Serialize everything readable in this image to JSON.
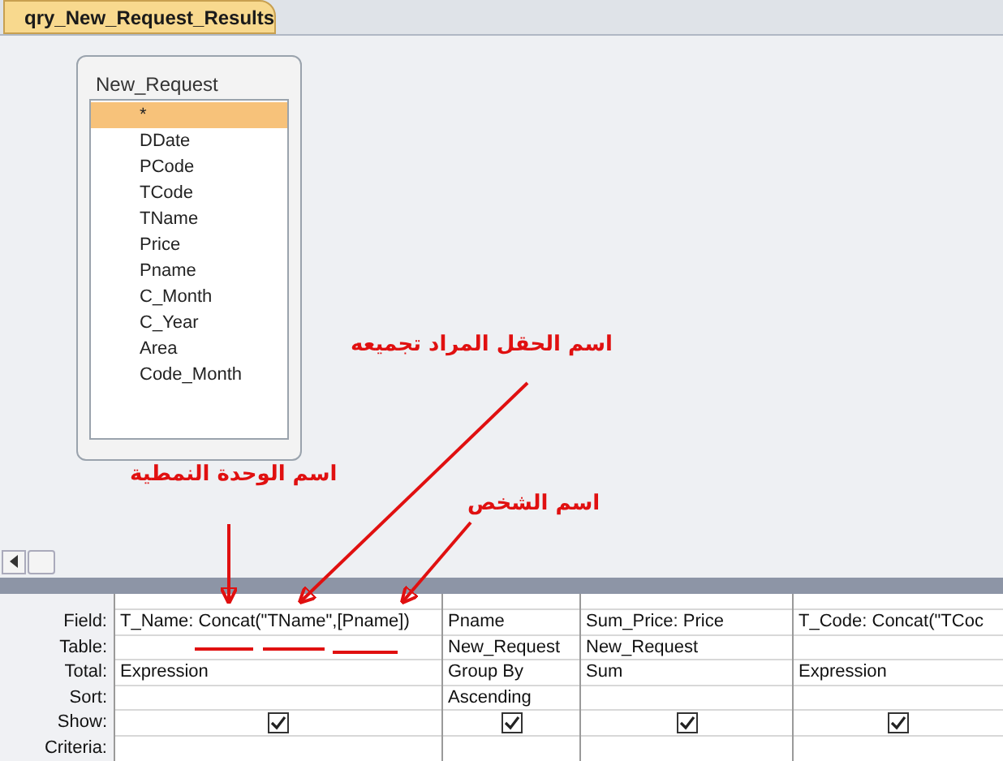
{
  "tab": {
    "title": "qry_New_Request_Results",
    "selected": true
  },
  "table_box": {
    "title": "New_Request",
    "fields": [
      {
        "name": "*",
        "selected": true
      },
      {
        "name": "DDate",
        "selected": false
      },
      {
        "name": "PCode",
        "selected": false
      },
      {
        "name": "TCode",
        "selected": false
      },
      {
        "name": "TName",
        "selected": false
      },
      {
        "name": "Price",
        "selected": false
      },
      {
        "name": "Pname",
        "selected": false
      },
      {
        "name": "C_Month",
        "selected": false
      },
      {
        "name": "C_Year",
        "selected": false
      },
      {
        "name": "Area",
        "selected": false
      },
      {
        "name": "Code_Month",
        "selected": false
      }
    ]
  },
  "annotations": [
    {
      "text": "اسم الحقل المراد تجميعه"
    },
    {
      "text": "اسم الوحدة النمطية"
    },
    {
      "text": "اسم الشخص"
    }
  ],
  "grid": {
    "row_labels": [
      "Field:",
      "Table:",
      "Total:",
      "Sort:",
      "Show:",
      "Criteria:"
    ],
    "columns": [
      {
        "field": "T_Name: Concat(\"TName\",[Pname])",
        "total": "Expression",
        "show": true
      },
      {
        "field": "Pname",
        "table": "New_Request",
        "total": "Group By",
        "sort": "Ascending",
        "show": true
      },
      {
        "field": "Sum_Price: Price",
        "table": "New_Request",
        "total": "Sum",
        "show": true
      },
      {
        "field": "T_Code: Concat(\"TCoc",
        "total": "Expression",
        "show": true
      }
    ]
  }
}
